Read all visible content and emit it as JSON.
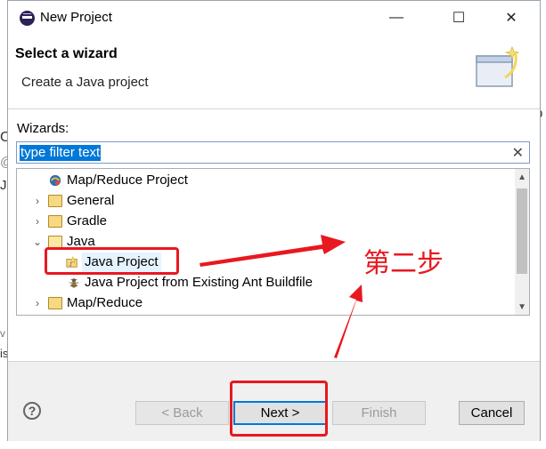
{
  "window": {
    "title": "New Project",
    "minimize_glyph": "—",
    "maximize_glyph": "☐",
    "close_glyph": "✕"
  },
  "header": {
    "title": "Select a wizard",
    "description": "Create a Java project"
  },
  "wizards": {
    "label": "Wizards:",
    "filter_value": "type filter text",
    "clear_glyph": "✕"
  },
  "tree": {
    "items": [
      {
        "label": "Map/Reduce Project",
        "icon": "mapreduce-project-icon",
        "twisty": ""
      },
      {
        "label": "General",
        "icon": "folder-icon",
        "twisty": "›"
      },
      {
        "label": "Gradle",
        "icon": "folder-icon",
        "twisty": "›"
      },
      {
        "label": "Java",
        "icon": "folder-open-icon",
        "twisty": "⌄"
      },
      {
        "label": "Java Project",
        "icon": "java-project-icon",
        "twisty": ""
      },
      {
        "label": "Java Project from Existing Ant Buildfile",
        "icon": "ant-buildfile-icon",
        "twisty": ""
      },
      {
        "label": "Map/Reduce",
        "icon": "folder-icon",
        "twisty": "›"
      }
    ]
  },
  "footer": {
    "help_glyph": "?",
    "back_label": "< Back",
    "next_label": "Next >",
    "finish_label": "Finish",
    "cancel_label": "Cancel"
  },
  "annotation": {
    "step_text": "第二步",
    "color": "#e8181f"
  },
  "background_fragments": [
    "p",
    "C",
    "@",
    "J",
    "v",
    "is"
  ]
}
